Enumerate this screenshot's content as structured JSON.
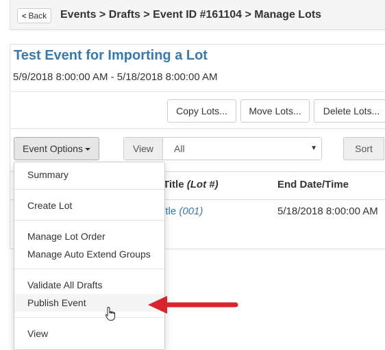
{
  "breadcrumb": {
    "back_label": "Back",
    "path": "Events > Drafts > Event ID #161104 > Manage Lots"
  },
  "event": {
    "title": "Test Event for Importing a Lot",
    "dates": "5/9/2018 8:00:00 AM - 5/18/2018 8:00:00 AM"
  },
  "actions": {
    "copy": "Copy Lots...",
    "move": "Move Lots...",
    "delete": "Delete Lots..."
  },
  "toolbar": {
    "options_label": "Event Options",
    "view_label": "View",
    "view_value": "All",
    "sort_label": "Sort"
  },
  "table": {
    "headers": {
      "title": "Title",
      "title_em": "(Lot #)",
      "end": "End Date/Time"
    },
    "row": {
      "title": "itle",
      "title_em": "(001)",
      "end": "5/18/2018 8:00:00 AM"
    }
  },
  "menu": {
    "items": [
      "Summary",
      "Create Lot",
      "Manage Lot Order",
      "Manage Auto Extend Groups",
      "Validate All Drafts",
      "Publish Event",
      "View"
    ]
  },
  "colors": {
    "link": "#337ab7",
    "highlight_arrow": "#d9242b"
  }
}
